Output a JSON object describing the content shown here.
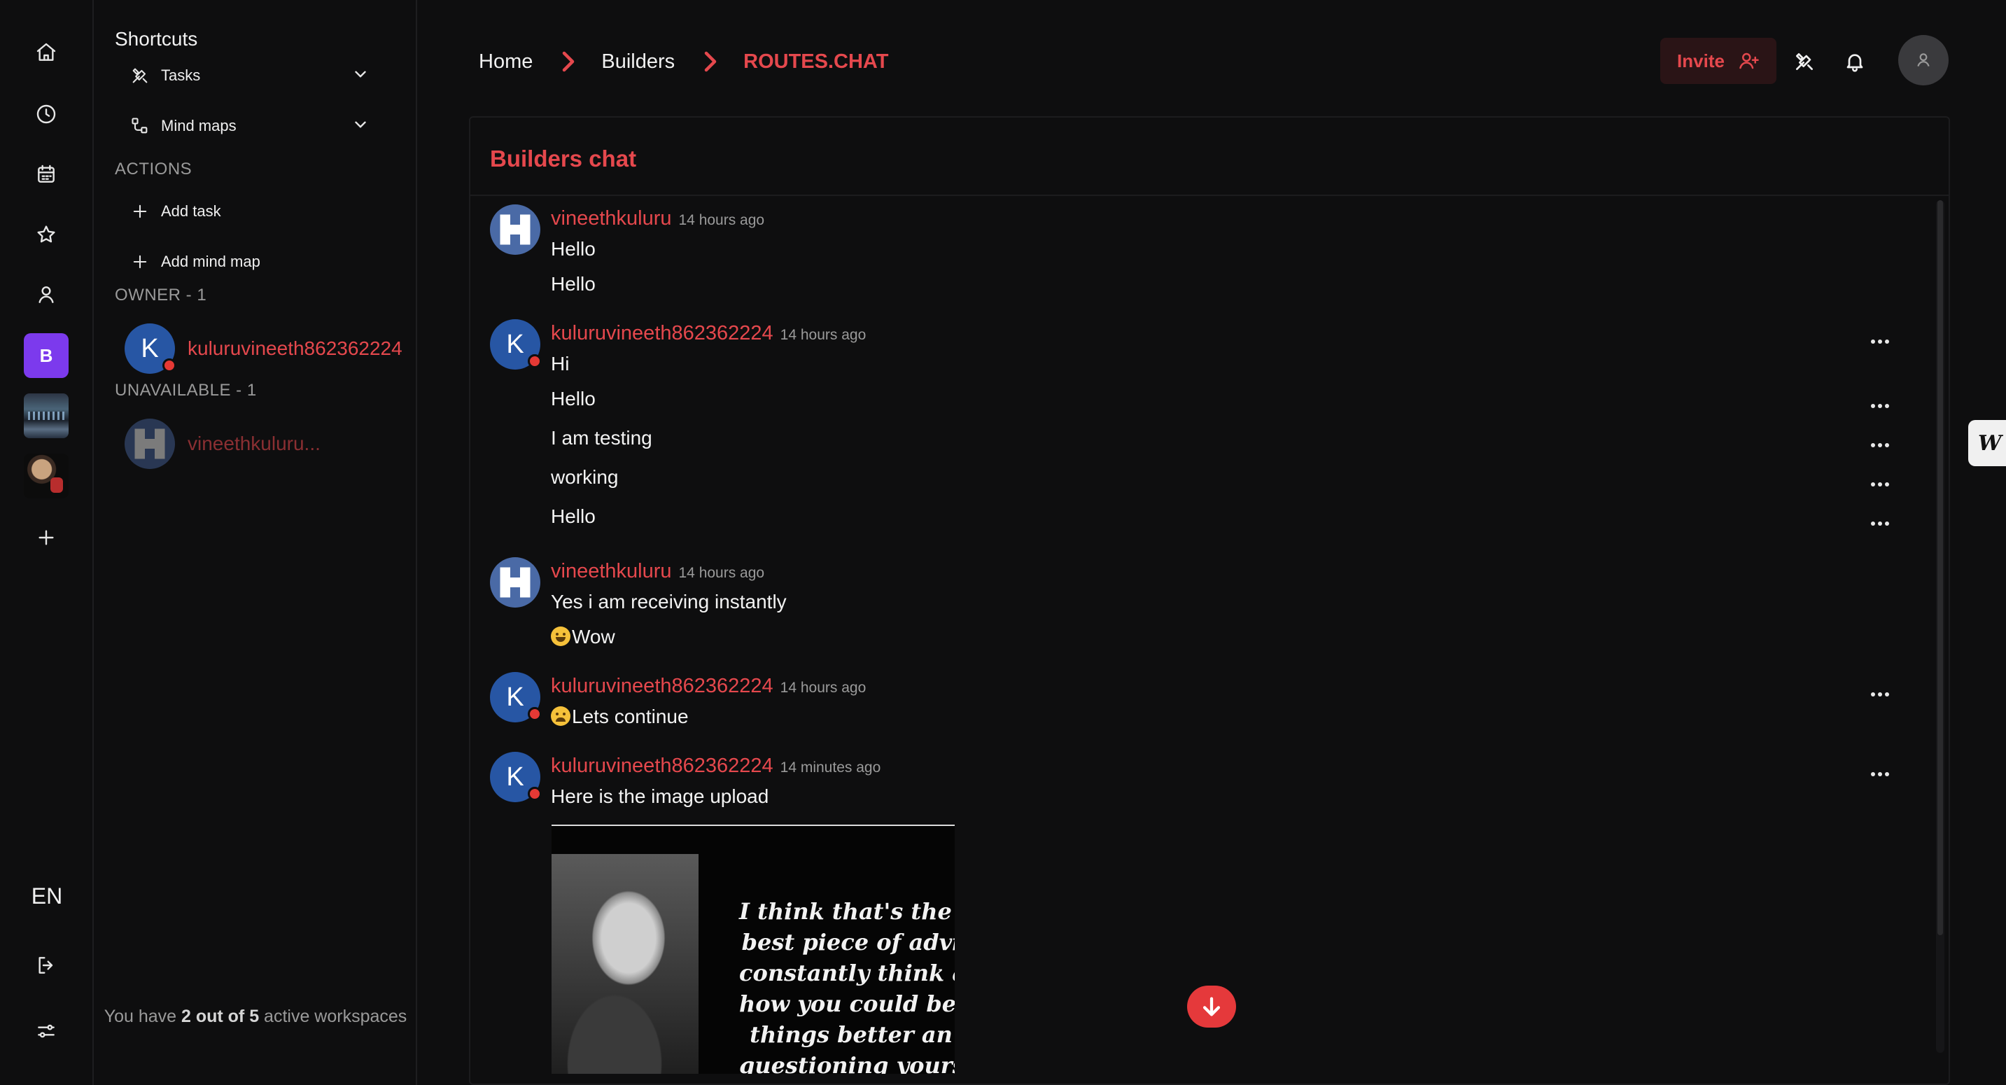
{
  "rail": {
    "items": [
      {
        "icon": "home-icon"
      },
      {
        "icon": "clock-icon"
      },
      {
        "icon": "calendar-icon"
      },
      {
        "icon": "star-icon"
      },
      {
        "icon": "user-icon"
      }
    ],
    "workspace_initial": "B",
    "lang": "EN"
  },
  "sidebar": {
    "shortcuts_title": "Shortcuts",
    "shortcuts": [
      {
        "label": "Tasks",
        "icon": "tools-icon"
      },
      {
        "label": "Mind maps",
        "icon": "mindmap-icon"
      }
    ],
    "actions_title": "ACTIONS",
    "actions": [
      {
        "label": "Add task",
        "icon": "plus-icon"
      },
      {
        "label": "Add mind map",
        "icon": "plus-icon"
      }
    ],
    "owner_title": "OWNER - 1",
    "owner": {
      "initial": "K",
      "name": "kuluruvineeth862362224"
    },
    "unavailable_title": "UNAVAILABLE - 1",
    "unavailable": {
      "name": "vineethkuluru..."
    },
    "workspaces_note": {
      "prefix": "You have ",
      "count": "2 out of 5",
      "suffix": " active workspaces"
    }
  },
  "header": {
    "breadcrumbs": [
      "Home",
      "Builders",
      "ROUTES.CHAT"
    ],
    "invite_label": "Invite"
  },
  "chat": {
    "title": "Builders chat",
    "groups": [
      {
        "user": "vineethkuluru",
        "time": "14 hours ago",
        "avatar": "identicon",
        "lines": [
          "Hello",
          "Hello"
        ]
      },
      {
        "user": "kuluruvineeth862362224",
        "time": "14 hours ago",
        "avatar": "K",
        "lines": [
          "Hi",
          "Hello",
          "I am testing",
          "working",
          "Hello"
        ]
      },
      {
        "user": "vineethkuluru",
        "time": "14 hours ago",
        "avatar": "identicon",
        "lines": [
          "Yes i am receiving instantly",
          "Wow"
        ]
      },
      {
        "user": "kuluruvineeth862362224",
        "time": "14 hours ago",
        "avatar": "K",
        "lines": [
          "Lets continue"
        ]
      },
      {
        "user": "kuluruvineeth862362224",
        "time": "14 minutes ago",
        "avatar": "K",
        "lines": [
          "Here is the image upload"
        ]
      }
    ],
    "image_quote": [
      "I think that's the si",
      "best piece of advi",
      "constantly think al",
      "how you could be d",
      "things better an",
      "questioning yours"
    ]
  },
  "side_tab": "W",
  "colors": {
    "accent": "#e5484d",
    "workspace": "#7c3aed",
    "avatar_k": "#2756a4",
    "background": "#0e0e0f"
  }
}
